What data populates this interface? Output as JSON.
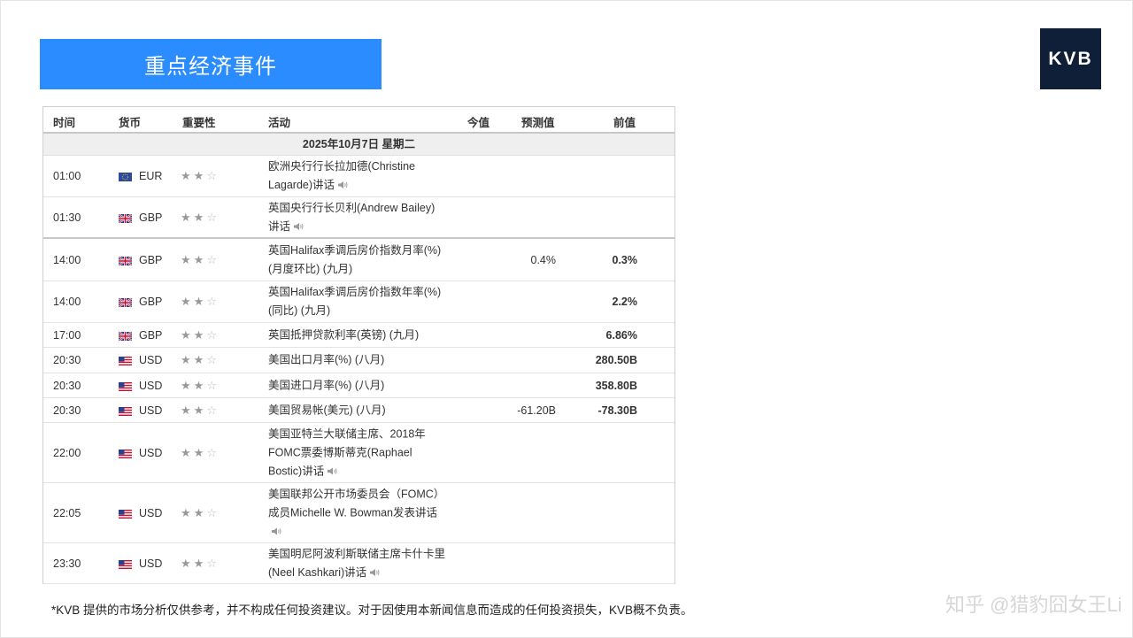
{
  "banner": {
    "title": "重点经济事件"
  },
  "logo": {
    "text": "KVB"
  },
  "table": {
    "headers": {
      "time": "时间",
      "currency": "货币",
      "importance": "重要性",
      "event": "活动",
      "actual": "今值",
      "forecast": "预测值",
      "previous": "前值"
    },
    "date": "2025年10月7日  星期二",
    "rows": [
      {
        "time": "01:00",
        "flag": "eu",
        "currency": "EUR",
        "stars": 2,
        "event": "欧洲央行行长拉加德(Christine Lagarde)讲话",
        "speaker": true,
        "forecast": "",
        "previous": ""
      },
      {
        "time": "01:30",
        "flag": "gb",
        "currency": "GBP",
        "stars": 2,
        "event": "英国央行行长贝利(Andrew Bailey)讲话",
        "speaker": true,
        "forecast": "",
        "previous": ""
      },
      {
        "time": "14:00",
        "flag": "gb",
        "currency": "GBP",
        "stars": 2,
        "event": "英国Halifax季调后房价指数月率(%) (月度环比) (九月)",
        "speaker": false,
        "forecast": "0.4%",
        "previous": "0.3%"
      },
      {
        "time": "14:00",
        "flag": "gb",
        "currency": "GBP",
        "stars": 2,
        "event": "英国Halifax季调后房价指数年率(%) (同比) (九月)",
        "speaker": false,
        "forecast": "",
        "previous": "2.2%"
      },
      {
        "time": "17:00",
        "flag": "gb",
        "currency": "GBP",
        "stars": 2,
        "event": "英国抵押贷款利率(英镑) (九月)",
        "speaker": false,
        "forecast": "",
        "previous": "6.86%"
      },
      {
        "time": "20:30",
        "flag": "us",
        "currency": "USD",
        "stars": 2,
        "event": "美国出口月率(%) (八月)",
        "speaker": false,
        "forecast": "",
        "previous": "280.50B"
      },
      {
        "time": "20:30",
        "flag": "us",
        "currency": "USD",
        "stars": 2,
        "event": "美国进口月率(%) (八月)",
        "speaker": false,
        "forecast": "",
        "previous": "358.80B"
      },
      {
        "time": "20:30",
        "flag": "us",
        "currency": "USD",
        "stars": 2,
        "event": "美国贸易帐(美元) (八月)",
        "speaker": false,
        "forecast": "-61.20B",
        "previous": "-78.30B"
      },
      {
        "time": "22:00",
        "flag": "us",
        "currency": "USD",
        "stars": 2,
        "event": "美国亚特兰大联储主席、2018年FOMC票委博斯蒂克(Raphael Bostic)讲话",
        "speaker": true,
        "forecast": "",
        "previous": ""
      },
      {
        "time": "22:05",
        "flag": "us",
        "currency": "USD",
        "stars": 2,
        "event": "美国联邦公开市场委员会（FOMC）成员Michelle W. Bowman发表讲话",
        "speaker": true,
        "forecast": "",
        "previous": ""
      },
      {
        "time": "23:30",
        "flag": "us",
        "currency": "USD",
        "stars": 2,
        "event": "美国明尼阿波利斯联储主席卡什卡里(Neel Kashkari)讲话",
        "speaker": true,
        "forecast": "",
        "previous": ""
      }
    ]
  },
  "disclaimer": "*KVB 提供的市场分析仅供参考，并不构成任何投资建议。对于因使用本新闻信息而造成的任何投资损失，KVB概不负责。",
  "watermark": "知乎 @猎豹囧女王Li"
}
